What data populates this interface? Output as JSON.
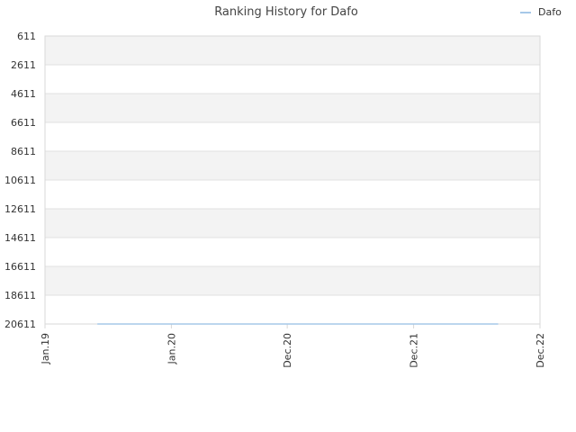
{
  "chart_data": {
    "type": "line",
    "title": "Ranking History for Dafo",
    "xlabel": "",
    "ylabel": "",
    "y_inverted": true,
    "ylim": [
      20611,
      611
    ],
    "y_ticks": [
      611,
      2611,
      4611,
      6611,
      8611,
      10611,
      12611,
      14611,
      16611,
      18611,
      20611
    ],
    "y_tick_labels": [
      "611",
      "2611",
      "4611",
      "6611",
      "8611",
      "10611",
      "12611",
      "14611",
      "16611",
      "18611",
      "20611"
    ],
    "x_range": [
      "2019-01",
      "2022-12"
    ],
    "x_ticks": [
      "2019-01",
      "2020-01",
      "2020-12",
      "2021-12",
      "2022-12"
    ],
    "x_tick_labels": [
      "Jan.19",
      "Jan.20",
      "Dec.20",
      "Dec.21",
      "Dec.22"
    ],
    "grid": true,
    "banded_background": true,
    "legend_position": "top-right",
    "series": [
      {
        "name": "Dafo",
        "color": "#a6c8e8",
        "points": [
          {
            "x": "2019-06",
            "y": 20611
          },
          {
            "x": "2022-08",
            "y": 20611
          }
        ]
      }
    ]
  },
  "colors": {
    "band": "#f3f3f3",
    "grid": "#e0e0e0",
    "axis": "#d8d8d8"
  }
}
